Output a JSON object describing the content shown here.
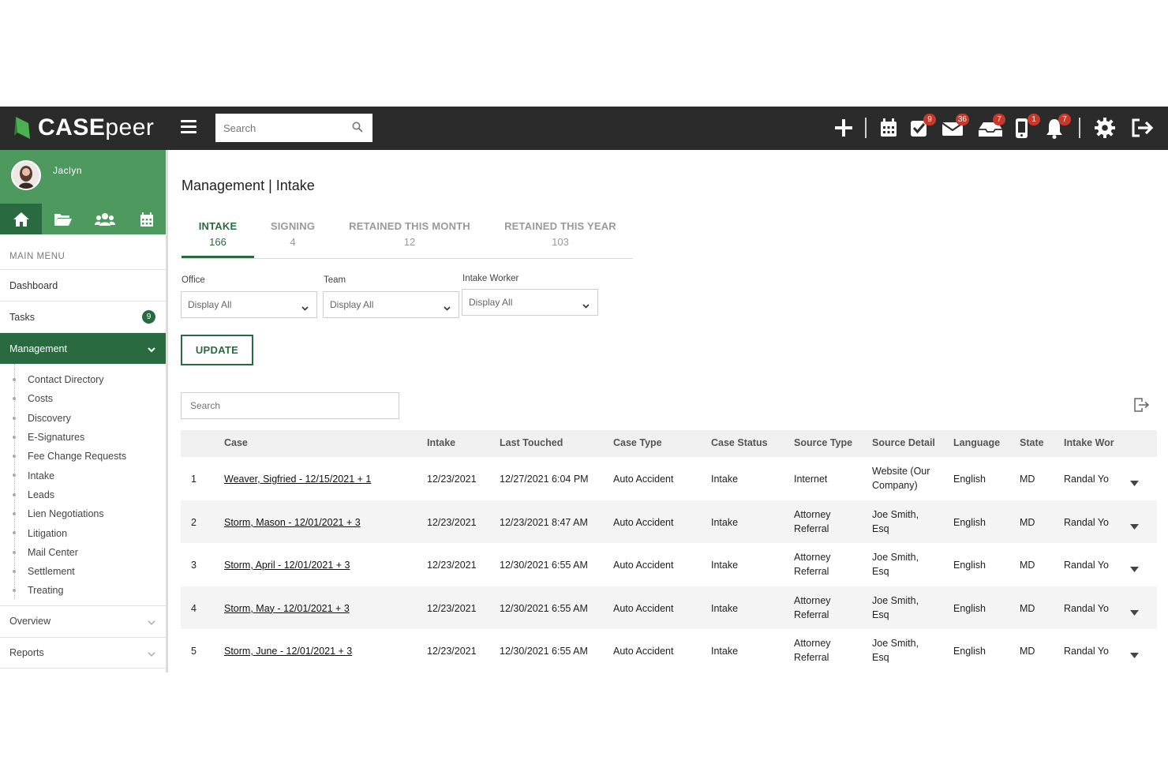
{
  "app": {
    "brand_main": "CASE",
    "brand_peer": "peer"
  },
  "top_search": {
    "placeholder": "Search"
  },
  "top_badges": {
    "tasks": "9",
    "mail": "36",
    "inbox": "7",
    "phone": "1",
    "notifications": "7"
  },
  "user": {
    "name": "Jaclyn"
  },
  "sidebar": {
    "heading": "MAIN MENU",
    "dashboard": "Dashboard",
    "tasks": "Tasks",
    "tasks_count": "9",
    "management": "Management",
    "management_items": [
      "Contact Directory",
      "Costs",
      "Discovery",
      "E-Signatures",
      "Fee Change Requests",
      "Intake",
      "Leads",
      "Lien Negotiations",
      "Litigation",
      "Mail Center",
      "Settlement",
      "Treating"
    ],
    "overview": "Overview",
    "reports": "Reports"
  },
  "page": {
    "title": "Management | Intake"
  },
  "tabs": [
    {
      "label": "INTAKE",
      "count": "166"
    },
    {
      "label": "SIGNING",
      "count": "4"
    },
    {
      "label": "RETAINED THIS MONTH",
      "count": "12"
    },
    {
      "label": "RETAINED THIS YEAR",
      "count": "103"
    }
  ],
  "filters": {
    "office_label": "Office",
    "office_value": "Display All",
    "team_label": "Team",
    "team_value": "Display All",
    "worker_label": "Intake Worker",
    "worker_value": "Display All",
    "update": "UPDATE"
  },
  "table_search": {
    "placeholder": "Search"
  },
  "table": {
    "headers": [
      "Case",
      "Intake",
      "Last Touched",
      "Case Type",
      "Case Status",
      "Source Type",
      "Source Detail",
      "Language",
      "State",
      "Intake Wor"
    ],
    "rows": [
      {
        "n": "1",
        "case": "Weaver, Sigfried - 12/15/2021 + 1",
        "intake": "12/23/2021",
        "touched": "12/27/2021 6:04 PM",
        "type": "Auto Accident",
        "status": "Intake",
        "source": "Internet",
        "detail": "Website (Our Company)",
        "lang": "English",
        "state": "MD",
        "worker": "Randal Yo"
      },
      {
        "n": "2",
        "case": "Storm, Mason - 12/01/2021 + 3",
        "intake": "12/23/2021",
        "touched": "12/23/2021 8:47 AM",
        "type": "Auto Accident",
        "status": "Intake",
        "source": "Attorney Referral",
        "detail": "Joe Smith, Esq",
        "lang": "English",
        "state": "MD",
        "worker": "Randal Yo"
      },
      {
        "n": "3",
        "case": "Storm, April - 12/01/2021 + 3",
        "intake": "12/23/2021",
        "touched": "12/30/2021 6:55 AM",
        "type": "Auto Accident",
        "status": "Intake",
        "source": "Attorney Referral",
        "detail": "Joe Smith, Esq",
        "lang": "English",
        "state": "MD",
        "worker": "Randal Yo"
      },
      {
        "n": "4",
        "case": "Storm, May - 12/01/2021 + 3",
        "intake": "12/23/2021",
        "touched": "12/30/2021 6:55 AM",
        "type": "Auto Accident",
        "status": "Intake",
        "source": "Attorney Referral",
        "detail": "Joe Smith, Esq",
        "lang": "English",
        "state": "MD",
        "worker": "Randal Yo"
      },
      {
        "n": "5",
        "case": "Storm, June - 12/01/2021 + 3",
        "intake": "12/23/2021",
        "touched": "12/30/2021 6:55 AM",
        "type": "Auto Accident",
        "status": "Intake",
        "source": "Attorney Referral",
        "detail": "Joe Smith, Esq",
        "lang": "English",
        "state": "MD",
        "worker": "Randal Yo"
      }
    ]
  },
  "colors": {
    "brand_green": "#2a6a41",
    "user_green": "#4e9a5e",
    "topbar": "#2b2b2b",
    "badge_red": "#c8382b"
  }
}
